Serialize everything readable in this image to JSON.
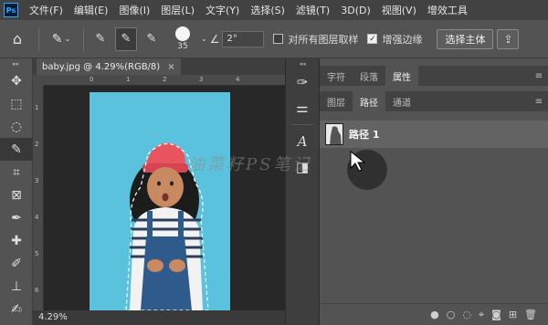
{
  "app": {
    "logo": "Ps"
  },
  "menu": [
    "文件(F)",
    "编辑(E)",
    "图像(I)",
    "图层(L)",
    "文字(Y)",
    "选择(S)",
    "滤镜(T)",
    "3D(D)",
    "视图(V)",
    "增效工具"
  ],
  "options": {
    "brush_size": "35",
    "angle_value": "2°",
    "sample_all_layers": {
      "label": "对所有图层取样",
      "checked": false
    },
    "enhance_edge": {
      "label": "增强边缘",
      "checked": true
    },
    "select_subject": "选择主体"
  },
  "document": {
    "tab_title": "baby.jpg @ 4.29%(RGB/8)",
    "zoom_status": "4.29%",
    "ruler_h": [
      "0",
      "1",
      "2",
      "3",
      "4"
    ],
    "ruler_v": [
      "1",
      "2",
      "3",
      "4",
      "5",
      "6"
    ]
  },
  "panels": {
    "top_tabs": [
      "字符",
      "段落",
      "属性"
    ],
    "top_active": "属性",
    "bottom_tabs": [
      "图层",
      "路径",
      "通道"
    ],
    "bottom_active": "路径",
    "path_item": "路径 1"
  },
  "watermark": "油菜籽PS笔记",
  "colors": {
    "menubar": "#424242",
    "ui": "#535353",
    "canvas_bg": "#282828",
    "photo_bg": "#5bc2dd",
    "hat": "#e8545f"
  },
  "icons": {
    "toolbar": [
      "move-icon",
      "marquee-icon",
      "lasso-icon",
      "quick-selection-icon",
      "crop-icon",
      "frame-icon",
      "eyedropper-icon",
      "healing-brush-icon",
      "brush-icon",
      "clone-stamp-icon",
      "history-brush-icon"
    ],
    "side_panel": [
      "brush-settings-icon",
      "adjustments-icon",
      "character-icon",
      "paragraph-icon"
    ]
  }
}
